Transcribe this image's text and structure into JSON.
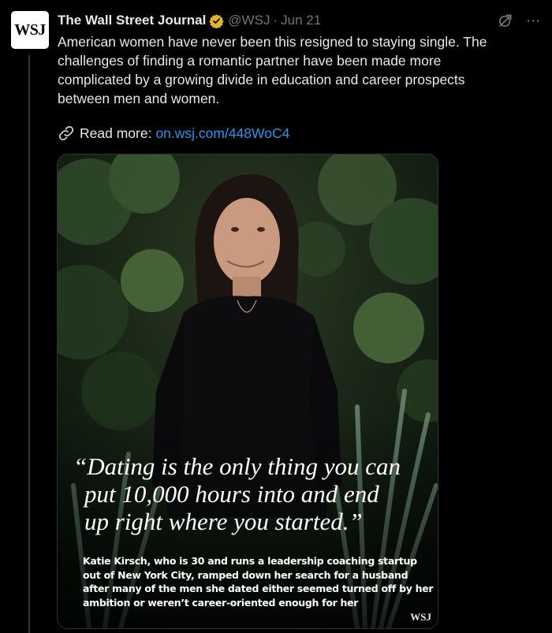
{
  "tweet": {
    "avatar_text": "WSJ",
    "author_name": "The Wall Street Journal",
    "handle": "@WSJ",
    "separator": "·",
    "date": "Jun 21",
    "verified_color": "#e2b719",
    "more_icon": "⋯",
    "body": "American women have never been this resigned to staying single. The challenges of finding a romantic partner have been made more complicated by a growing divide in education and career prospects between men and women.",
    "read_more_label": "Read more:",
    "read_more_url": "on.wsj.com/448WoC4",
    "link_color": "#1d9bf0"
  },
  "media": {
    "quote_lines": [
      "“Dating is the only thing you can",
      "put 10,000 hours into and end",
      "up right where you started.”"
    ],
    "caption_lines": [
      "Katie Kirsch, who is 30 and runs a leadership coaching startup",
      "out of New York City, ramped down her search for a husband",
      "after many of the men she dated either seemed turned off by her",
      "ambition or weren’t career-oriented enough for her"
    ],
    "watermark": "WSJ"
  }
}
